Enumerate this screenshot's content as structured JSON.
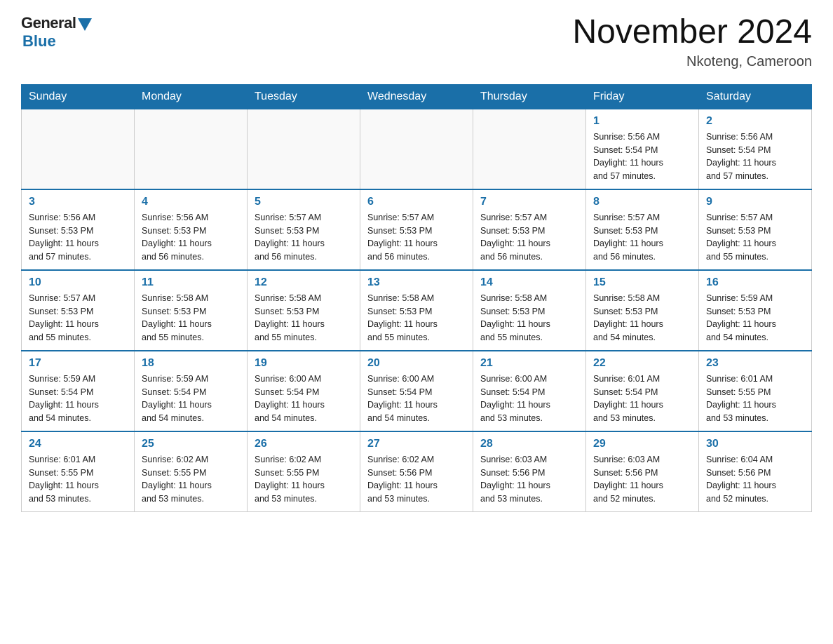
{
  "logo": {
    "general": "General",
    "blue": "Blue"
  },
  "title": "November 2024",
  "location": "Nkoteng, Cameroon",
  "days_of_week": [
    "Sunday",
    "Monday",
    "Tuesday",
    "Wednesday",
    "Thursday",
    "Friday",
    "Saturday"
  ],
  "weeks": [
    [
      {
        "day": "",
        "info": ""
      },
      {
        "day": "",
        "info": ""
      },
      {
        "day": "",
        "info": ""
      },
      {
        "day": "",
        "info": ""
      },
      {
        "day": "",
        "info": ""
      },
      {
        "day": "1",
        "info": "Sunrise: 5:56 AM\nSunset: 5:54 PM\nDaylight: 11 hours\nand 57 minutes."
      },
      {
        "day": "2",
        "info": "Sunrise: 5:56 AM\nSunset: 5:54 PM\nDaylight: 11 hours\nand 57 minutes."
      }
    ],
    [
      {
        "day": "3",
        "info": "Sunrise: 5:56 AM\nSunset: 5:53 PM\nDaylight: 11 hours\nand 57 minutes."
      },
      {
        "day": "4",
        "info": "Sunrise: 5:56 AM\nSunset: 5:53 PM\nDaylight: 11 hours\nand 56 minutes."
      },
      {
        "day": "5",
        "info": "Sunrise: 5:57 AM\nSunset: 5:53 PM\nDaylight: 11 hours\nand 56 minutes."
      },
      {
        "day": "6",
        "info": "Sunrise: 5:57 AM\nSunset: 5:53 PM\nDaylight: 11 hours\nand 56 minutes."
      },
      {
        "day": "7",
        "info": "Sunrise: 5:57 AM\nSunset: 5:53 PM\nDaylight: 11 hours\nand 56 minutes."
      },
      {
        "day": "8",
        "info": "Sunrise: 5:57 AM\nSunset: 5:53 PM\nDaylight: 11 hours\nand 56 minutes."
      },
      {
        "day": "9",
        "info": "Sunrise: 5:57 AM\nSunset: 5:53 PM\nDaylight: 11 hours\nand 55 minutes."
      }
    ],
    [
      {
        "day": "10",
        "info": "Sunrise: 5:57 AM\nSunset: 5:53 PM\nDaylight: 11 hours\nand 55 minutes."
      },
      {
        "day": "11",
        "info": "Sunrise: 5:58 AM\nSunset: 5:53 PM\nDaylight: 11 hours\nand 55 minutes."
      },
      {
        "day": "12",
        "info": "Sunrise: 5:58 AM\nSunset: 5:53 PM\nDaylight: 11 hours\nand 55 minutes."
      },
      {
        "day": "13",
        "info": "Sunrise: 5:58 AM\nSunset: 5:53 PM\nDaylight: 11 hours\nand 55 minutes."
      },
      {
        "day": "14",
        "info": "Sunrise: 5:58 AM\nSunset: 5:53 PM\nDaylight: 11 hours\nand 55 minutes."
      },
      {
        "day": "15",
        "info": "Sunrise: 5:58 AM\nSunset: 5:53 PM\nDaylight: 11 hours\nand 54 minutes."
      },
      {
        "day": "16",
        "info": "Sunrise: 5:59 AM\nSunset: 5:53 PM\nDaylight: 11 hours\nand 54 minutes."
      }
    ],
    [
      {
        "day": "17",
        "info": "Sunrise: 5:59 AM\nSunset: 5:54 PM\nDaylight: 11 hours\nand 54 minutes."
      },
      {
        "day": "18",
        "info": "Sunrise: 5:59 AM\nSunset: 5:54 PM\nDaylight: 11 hours\nand 54 minutes."
      },
      {
        "day": "19",
        "info": "Sunrise: 6:00 AM\nSunset: 5:54 PM\nDaylight: 11 hours\nand 54 minutes."
      },
      {
        "day": "20",
        "info": "Sunrise: 6:00 AM\nSunset: 5:54 PM\nDaylight: 11 hours\nand 54 minutes."
      },
      {
        "day": "21",
        "info": "Sunrise: 6:00 AM\nSunset: 5:54 PM\nDaylight: 11 hours\nand 53 minutes."
      },
      {
        "day": "22",
        "info": "Sunrise: 6:01 AM\nSunset: 5:54 PM\nDaylight: 11 hours\nand 53 minutes."
      },
      {
        "day": "23",
        "info": "Sunrise: 6:01 AM\nSunset: 5:55 PM\nDaylight: 11 hours\nand 53 minutes."
      }
    ],
    [
      {
        "day": "24",
        "info": "Sunrise: 6:01 AM\nSunset: 5:55 PM\nDaylight: 11 hours\nand 53 minutes."
      },
      {
        "day": "25",
        "info": "Sunrise: 6:02 AM\nSunset: 5:55 PM\nDaylight: 11 hours\nand 53 minutes."
      },
      {
        "day": "26",
        "info": "Sunrise: 6:02 AM\nSunset: 5:55 PM\nDaylight: 11 hours\nand 53 minutes."
      },
      {
        "day": "27",
        "info": "Sunrise: 6:02 AM\nSunset: 5:56 PM\nDaylight: 11 hours\nand 53 minutes."
      },
      {
        "day": "28",
        "info": "Sunrise: 6:03 AM\nSunset: 5:56 PM\nDaylight: 11 hours\nand 53 minutes."
      },
      {
        "day": "29",
        "info": "Sunrise: 6:03 AM\nSunset: 5:56 PM\nDaylight: 11 hours\nand 52 minutes."
      },
      {
        "day": "30",
        "info": "Sunrise: 6:04 AM\nSunset: 5:56 PM\nDaylight: 11 hours\nand 52 minutes."
      }
    ]
  ]
}
